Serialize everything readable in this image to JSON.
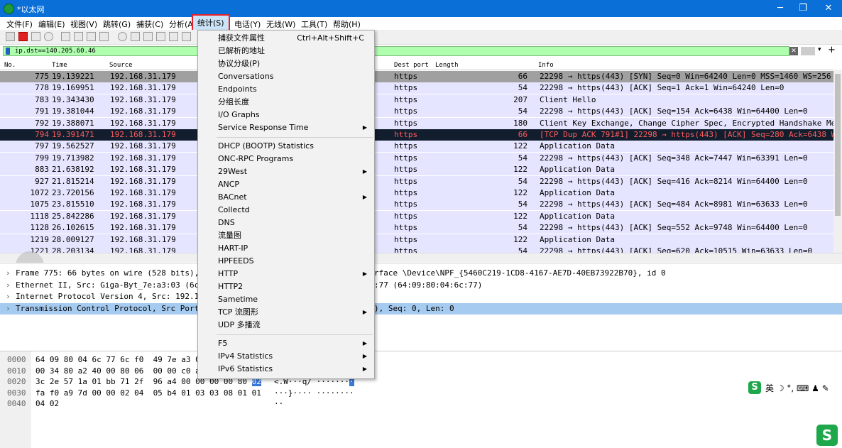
{
  "window": {
    "title": "*以太网",
    "minimize": "─",
    "maximize": "❐",
    "close": "✕"
  },
  "menubar": {
    "items": [
      "文件(F)",
      "编辑(E)",
      "视图(V)",
      "跳转(G)",
      "捕获(C)",
      "分析(A)",
      "统计(S)",
      "电话(Y)",
      "无线(W)",
      "工具(T)",
      "帮助(H)"
    ]
  },
  "filter": {
    "value": "ip.dst==140.205.60.46"
  },
  "columns": [
    "No.",
    "Time",
    "Source",
    "Dest port",
    "Length",
    "Info"
  ],
  "packets": [
    {
      "no": "775",
      "time": "19.139221",
      "src": "192.168.31.179",
      "dport": "https",
      "len": "66",
      "info": "22298 → https(443) [SYN] Seq=0 Win=64240 Len=0 MSS=1460 WS=256",
      "style": "gray"
    },
    {
      "no": "778",
      "time": "19.169951",
      "src": "192.168.31.179",
      "dport": "https",
      "len": "54",
      "info": "22298 → https(443) [ACK] Seq=1 Ack=1 Win=64240 Len=0",
      "style": ""
    },
    {
      "no": "783",
      "time": "19.343430",
      "src": "192.168.31.179",
      "dport": "https",
      "len": "207",
      "info": "Client Hello",
      "style": ""
    },
    {
      "no": "791",
      "time": "19.381044",
      "src": "192.168.31.179",
      "dport": "https",
      "len": "54",
      "info": "22298 → https(443) [ACK] Seq=154 Ack=6438 Win=64400 Len=0",
      "style": ""
    },
    {
      "no": "792",
      "time": "19.388071",
      "src": "192.168.31.179",
      "dport": "https",
      "len": "180",
      "info": "Client Key Exchange, Change Cipher Spec, Encrypted Handshake Me",
      "style": ""
    },
    {
      "no": "794",
      "time": "19.391471",
      "src": "192.168.31.179",
      "dport": "https",
      "len": "66",
      "info": "[TCP Dup ACK 791#1] 22298 → https(443) [ACK] Seq=280 Ack=6438 W",
      "style": "dark"
    },
    {
      "no": "797",
      "time": "19.562527",
      "src": "192.168.31.179",
      "dport": "https",
      "len": "122",
      "info": "Application Data",
      "style": ""
    },
    {
      "no": "799",
      "time": "19.713982",
      "src": "192.168.31.179",
      "dport": "https",
      "len": "54",
      "info": "22298 → https(443) [ACK] Seq=348 Ack=7447 Win=63391 Len=0",
      "style": ""
    },
    {
      "no": "883",
      "time": "21.638192",
      "src": "192.168.31.179",
      "dport": "https",
      "len": "122",
      "info": "Application Data",
      "style": ""
    },
    {
      "no": "927",
      "time": "21.815214",
      "src": "192.168.31.179",
      "dport": "https",
      "len": "54",
      "info": "22298 → https(443) [ACK] Seq=416 Ack=8214 Win=64400 Len=0",
      "style": ""
    },
    {
      "no": "1072",
      "time": "23.720156",
      "src": "192.168.31.179",
      "dport": "https",
      "len": "122",
      "info": "Application Data",
      "style": ""
    },
    {
      "no": "1075",
      "time": "23.815510",
      "src": "192.168.31.179",
      "dport": "https",
      "len": "54",
      "info": "22298 → https(443) [ACK] Seq=484 Ack=8981 Win=63633 Len=0",
      "style": ""
    },
    {
      "no": "1118",
      "time": "25.842286",
      "src": "192.168.31.179",
      "dport": "https",
      "len": "122",
      "info": "Application Data",
      "style": ""
    },
    {
      "no": "1128",
      "time": "26.102615",
      "src": "192.168.31.179",
      "dport": "https",
      "len": "54",
      "info": "22298 → https(443) [ACK] Seq=552 Ack=9748 Win=64400 Len=0",
      "style": ""
    },
    {
      "no": "1219",
      "time": "28.009127",
      "src": "192.168.31.179",
      "dport": "https",
      "len": "122",
      "info": "Application Data",
      "style": ""
    },
    {
      "no": "1221",
      "time": "28.203134",
      "src": "192.168.31.179",
      "dport": "https",
      "len": "54",
      "info": "22298 → https(443) [ACK] Seq=620 Ack=10515 Win=63633 Len=0",
      "style": ""
    }
  ],
  "details": [
    {
      "left": "Frame 775: 66 bytes on wire (528 bits),",
      "right": "rface \\Device\\NPF_{5460C219-1CD8-4167-AE7D-40EB73922B70}, id 0",
      "sel": false
    },
    {
      "left": "Ethernet II, Src: Giga-Byt_7e:a3:03 (6c",
      "right": ":77 (64:09:80:04:6c:77)",
      "sel": false
    },
    {
      "left": "Internet Protocol Version 4, Src: 192.1",
      "right": "",
      "sel": false
    },
    {
      "left": "Transmission Control Protocol, Src Port",
      "right": "), Seq: 0, Len: 0",
      "sel": true
    }
  ],
  "bytes": [
    {
      "off": "0000",
      "hex": "64 09 80 04 6c 77 6c f0  49 7e a3 0",
      "ascii": ""
    },
    {
      "off": "0010",
      "hex": "00 34 80 a2 40 00 80 06  00 00 c0 a",
      "ascii": ""
    },
    {
      "off": "0020",
      "hex": "3c 2e 57 1a 01 bb 71 2f  96 a4 00 00 00 00 80 ",
      "hexhl": "02",
      "ascii": "<.W···q/ ·······",
      "asciihl": "·"
    },
    {
      "off": "0030",
      "hex": "fa f0 a9 7d 00 00 02 04  05 b4 01 03 03 08 01 01",
      "ascii": "···}···· ········"
    },
    {
      "off": "0040",
      "hex": "04 02",
      "ascii": "··"
    }
  ],
  "stats_menu": [
    {
      "label": "捕获文件属性",
      "shortcut": "Ctrl+Alt+Shift+C",
      "sub": false
    },
    {
      "label": "已解析的地址",
      "sub": false
    },
    {
      "label": "协议分级(P)",
      "sub": false
    },
    {
      "label": "Conversations",
      "sub": false
    },
    {
      "label": "Endpoints",
      "sub": false
    },
    {
      "label": "分组长度",
      "sub": false
    },
    {
      "label": "I/O Graphs",
      "sub": false
    },
    {
      "label": "Service Response Time",
      "sub": true
    },
    {
      "sep": true
    },
    {
      "label": "DHCP (BOOTP) Statistics",
      "sub": false
    },
    {
      "label": "ONC-RPC Programs",
      "sub": false
    },
    {
      "label": "29West",
      "sub": true
    },
    {
      "label": "ANCP",
      "sub": false
    },
    {
      "label": "BACnet",
      "sub": true
    },
    {
      "label": "Collectd",
      "sub": false
    },
    {
      "label": "DNS",
      "sub": false
    },
    {
      "label": "流量图",
      "sub": false
    },
    {
      "label": "HART-IP",
      "sub": false
    },
    {
      "label": "HPFEEDS",
      "sub": false
    },
    {
      "label": "HTTP",
      "sub": true
    },
    {
      "label": "HTTP2",
      "sub": false
    },
    {
      "label": "Sametime",
      "sub": false
    },
    {
      "label": "TCP 流图形",
      "sub": true
    },
    {
      "label": "UDP 多播流",
      "sub": false
    },
    {
      "sep": true
    },
    {
      "label": "F5",
      "sub": true
    },
    {
      "label": "IPv4 Statistics",
      "sub": true
    },
    {
      "label": "IPv6 Statistics",
      "sub": true
    }
  ],
  "ime": {
    "logo": "S",
    "text": "英 ☽ °, ⌨ ♟ ✎",
    "logo2": "S"
  },
  "colors": {
    "accent": "#0a6fd6",
    "highlight_border": "#e8202a",
    "filter_ok": "#afffaf"
  }
}
